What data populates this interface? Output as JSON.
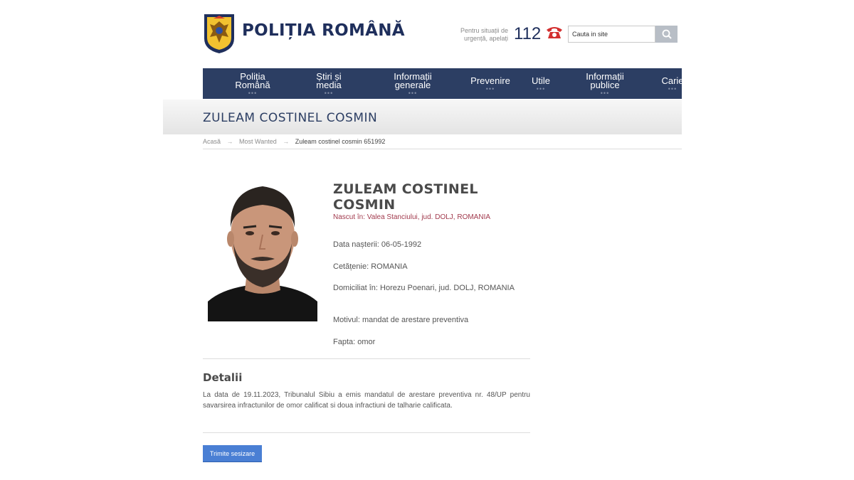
{
  "header": {
    "brand": "POLIȚIA ROMÂNĂ",
    "emergency_line1": "Pentru situații de",
    "emergency_line2": "urgență, apelați",
    "emergency_number": "112",
    "search_placeholder": "Cauta in site"
  },
  "nav": {
    "items": [
      {
        "label": "Poliția\nRomână"
      },
      {
        "label": "Știri și\nmedia"
      },
      {
        "label": "Informații\ngenerale"
      },
      {
        "label": "Prevenire"
      },
      {
        "label": "Utile"
      },
      {
        "label": "Informații\npublice"
      },
      {
        "label": "Carie"
      }
    ]
  },
  "page_title": "ZULEAM COSTINEL COSMIN",
  "breadcrumb": {
    "home": "Acasă",
    "section": "Most Wanted",
    "current": "Zuleam costinel cosmin 651992"
  },
  "profile": {
    "name": "ZULEAM COSTINEL COSMIN",
    "born": "Nascut în: Valea Stanciului, jud. DOLJ, ROMANIA",
    "birth_date": "Data nașterii: 06-05-1992",
    "citizenship": "Cetățenie: ROMANIA",
    "domicile": "Domiciliat în: Horezu Poenari, jud. DOLJ, ROMANIA",
    "reason": "Motivul: mandat de arestare preventiva",
    "offense": "Fapta: omor"
  },
  "details": {
    "heading": "Detalii",
    "text": "La data de 19.11.2023, Tribunalul Sibiu a emis mandatul de arestare preventiva nr. 48/UP pentru savarsirea infractunilor de omor calificat si doua infractiuni de talharie calificata."
  },
  "actions": {
    "send_report": "Trimite sesizare"
  },
  "colors": {
    "navy": "#2c3e63",
    "accent_red": "#a23b4e",
    "button_blue": "#4a7fd4"
  }
}
